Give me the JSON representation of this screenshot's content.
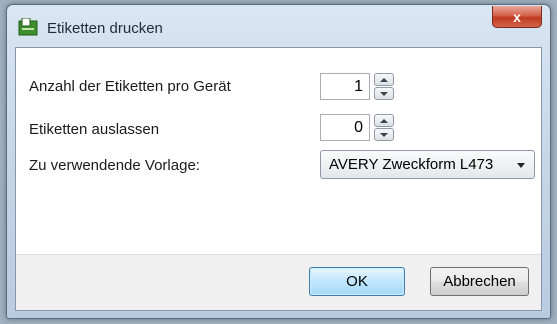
{
  "dialog": {
    "title": "Etiketten drucken",
    "icon": "label-printer-icon",
    "close_label": "x"
  },
  "fields": {
    "labels_per_device": {
      "label": "Anzahl der Etiketten pro Gerät",
      "value": "1"
    },
    "skip_labels": {
      "label": "Etiketten auslassen",
      "value": "0"
    },
    "template": {
      "label": "Zu verwendende Vorlage:",
      "selected": "AVERY Zweckform L473"
    }
  },
  "buttons": {
    "ok": "OK",
    "cancel": "Abbrechen"
  },
  "colors": {
    "ok_accent": "#3c7fb1",
    "close_red": "#c0391f",
    "icon_green": "#3c8f2c"
  }
}
